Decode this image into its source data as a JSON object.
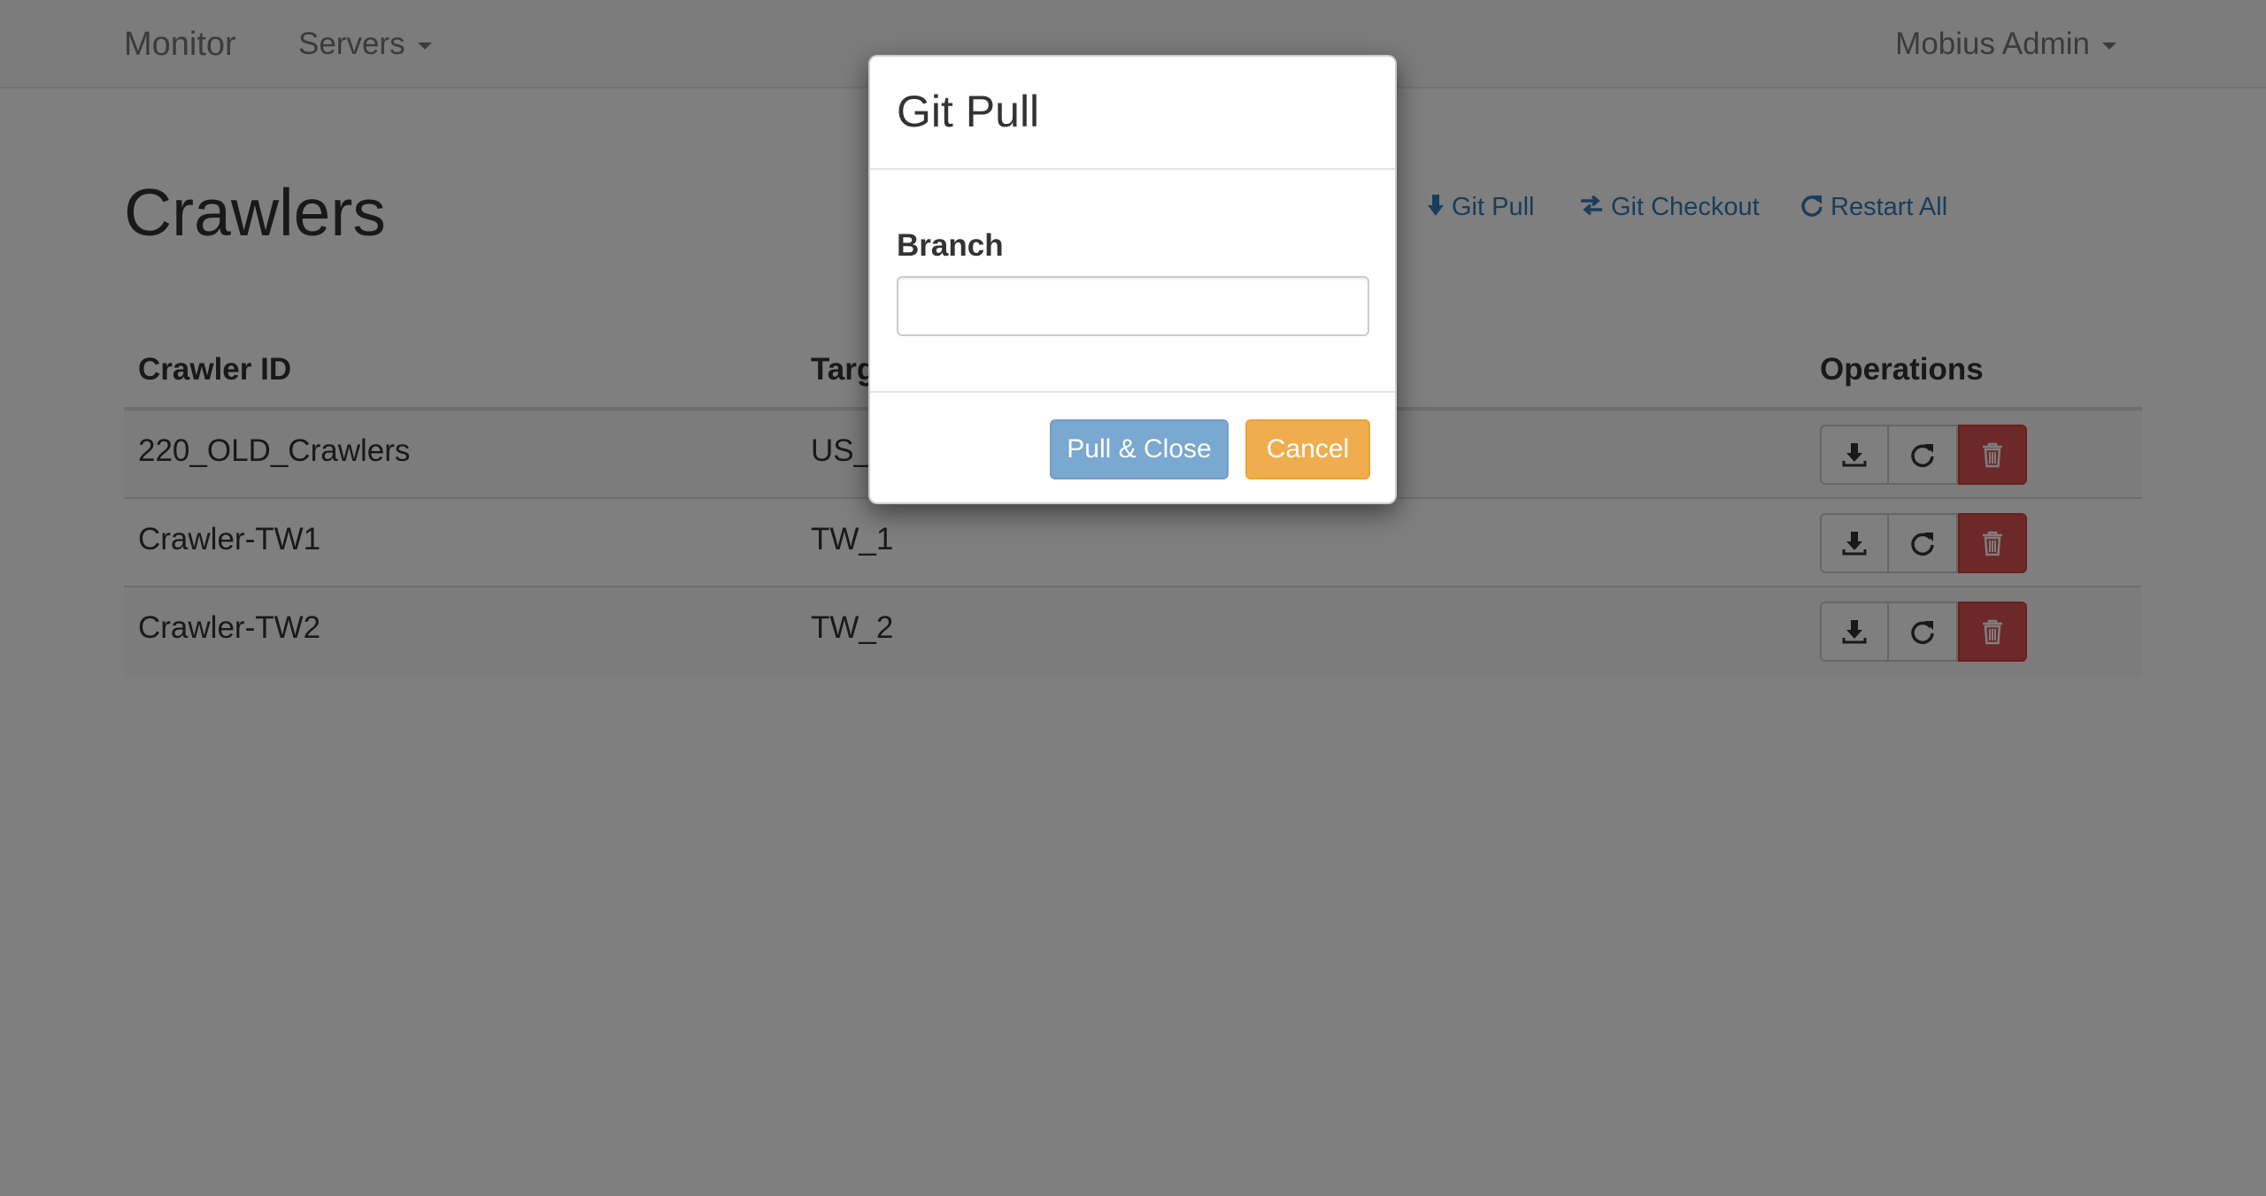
{
  "navbar": {
    "brand": "Monitor",
    "servers_label": "Servers",
    "user_label": "Mobius Admin"
  },
  "page": {
    "title": "Crawlers",
    "actions": {
      "git_pull": "Git Pull",
      "git_checkout": "Git Checkout",
      "restart_all": "Restart All"
    }
  },
  "table": {
    "headers": [
      "Crawler ID",
      "Target",
      "Operations"
    ],
    "rows": [
      {
        "crawler_id": "220_OLD_Crawlers",
        "target": "US_"
      },
      {
        "crawler_id": "Crawler-TW1",
        "target": "TW_1"
      },
      {
        "crawler_id": "Crawler-TW2",
        "target": "TW_2"
      }
    ],
    "operation_icons": [
      "download-icon",
      "refresh-icon",
      "trash-icon"
    ]
  },
  "modal": {
    "title": "Git Pull",
    "branch_label": "Branch",
    "branch_value": "",
    "branch_placeholder": "",
    "pull_close_label": "Pull & Close",
    "cancel_label": "Cancel"
  },
  "colors": {
    "link": "#337ab7",
    "primary": "#337ab7",
    "warning": "#f0ad4e",
    "danger": "#d9534f",
    "backdrop_opacity": 0.5
  }
}
